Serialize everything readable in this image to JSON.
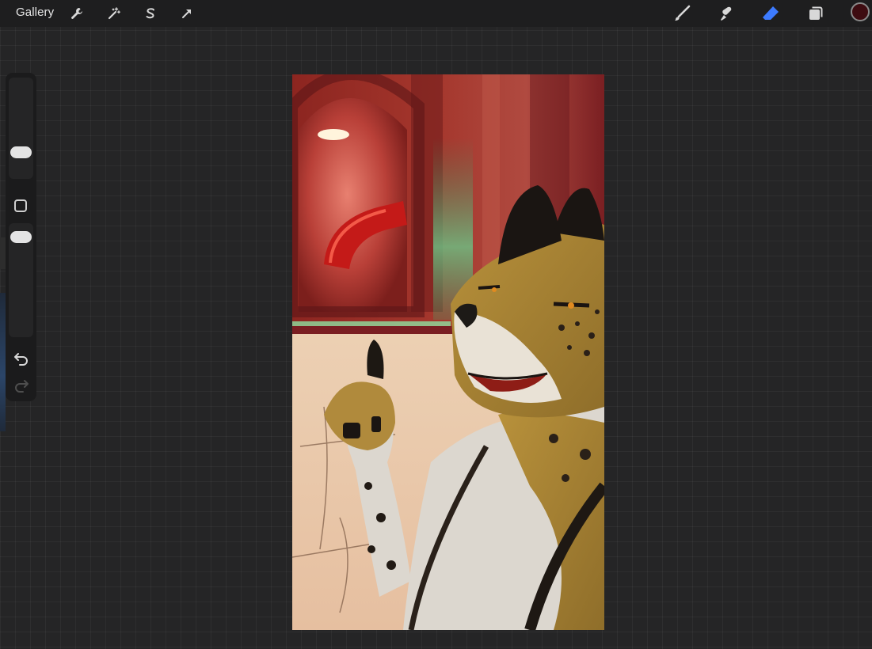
{
  "app": {
    "gallery_label": "Gallery"
  },
  "toolbar": {
    "left_icons": [
      "wrench-icon",
      "magic-wand-icon",
      "selection-s-icon",
      "transform-arrow-icon"
    ],
    "right_icons": [
      "brush-icon",
      "smudge-icon",
      "eraser-icon",
      "layers-icon"
    ],
    "active_tool": "eraser",
    "active_tool_color": "#3d7bff",
    "current_color": "#3e0c11"
  },
  "sidebar": {
    "brush_size_level": 0.28,
    "opacity_level": 0.35,
    "icons": [
      "modify-square-icon",
      "undo-icon",
      "redo-icon"
    ]
  },
  "colors": {
    "background": "#252526",
    "toolbar_bg": "#1e1e1f",
    "sidebar_bg": "#1b1b1c"
  }
}
